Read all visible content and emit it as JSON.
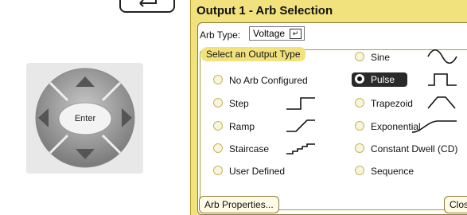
{
  "dialog": {
    "title": "Output 1 - Arb Selection",
    "arb_type_label": "Arb Type:",
    "arb_type_value": "Voltage",
    "group_label": "Select an Output Type",
    "options_left": [
      "No Arb Configured",
      "Step",
      "Ramp",
      "Staircase",
      "User Defined"
    ],
    "options_right": [
      "Sine",
      "Pulse",
      "Trapezoid",
      "Exponential",
      "Constant Dwell (CD)",
      "Sequence"
    ],
    "selected": "Pulse",
    "arb_properties_label": "Arb Properties...",
    "close_label": "Close"
  },
  "dpad": {
    "enter_label": "Enter"
  },
  "colors": {
    "dialog_bg": "#f2e27e",
    "selected_bg": "#2a2a2a"
  }
}
